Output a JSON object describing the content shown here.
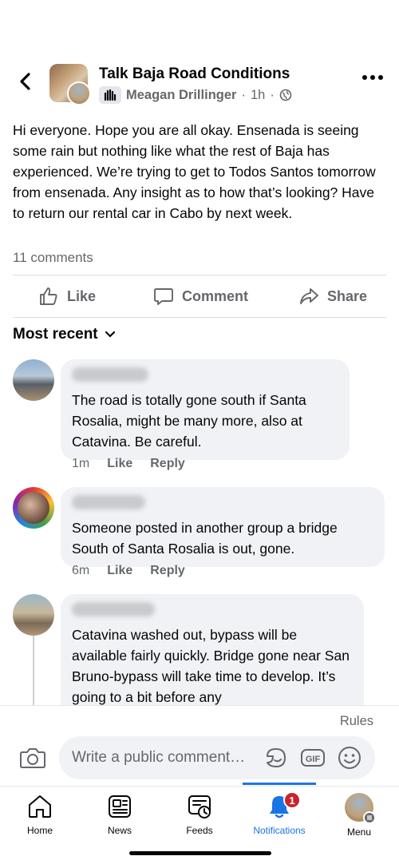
{
  "header": {
    "group_name": "Talk Baja Road Conditions",
    "author": "Meagan Drillinger",
    "time": "1h",
    "separator": "·"
  },
  "post": {
    "text": "Hi everyone. Hope you are all okay. Ensenada is seeing some rain but nothing like what the rest of Baja has experienced. We’re trying to get to Todos Santos tomorrow from ensenada. Any insight as to how that’s looking? Have to return our rental car in Cabo by next week.",
    "comments_count": "11 comments"
  },
  "actions": {
    "like": "Like",
    "comment": "Comment",
    "share": "Share"
  },
  "sort": {
    "label": "Most recent"
  },
  "comments": [
    {
      "text": "The road is totally gone south if Santa Rosalia, might be many more, also at Catavina. Be careful.",
      "time": "1m",
      "like": "Like",
      "reply": "Reply"
    },
    {
      "text": "Someone posted in another group a bridge South of Santa Rosalia is out, gone.",
      "time": "6m",
      "like": "Like",
      "reply": "Reply"
    },
    {
      "text": "Catavina washed out, bypass will be available fairly quickly. Bridge gone near San Bruno-bypass will take time to develop. It’s going to a bit before any"
    }
  ],
  "composer": {
    "rules": "Rules",
    "placeholder": "Write a public comment…",
    "gif": "GIF"
  },
  "tabs": [
    {
      "label": "Home",
      "icon": "home-icon"
    },
    {
      "label": "News",
      "icon": "news-icon"
    },
    {
      "label": "Feeds",
      "icon": "feeds-icon"
    },
    {
      "label": "Notifications",
      "icon": "bell-icon",
      "badge": "1",
      "active": true
    },
    {
      "label": "Menu",
      "icon": "profile-avatar"
    }
  ],
  "colors": {
    "accent": "#1b74e4",
    "badge": "#c8232c",
    "bubble": "#f0f2f5",
    "secondary_text": "#65676b"
  }
}
